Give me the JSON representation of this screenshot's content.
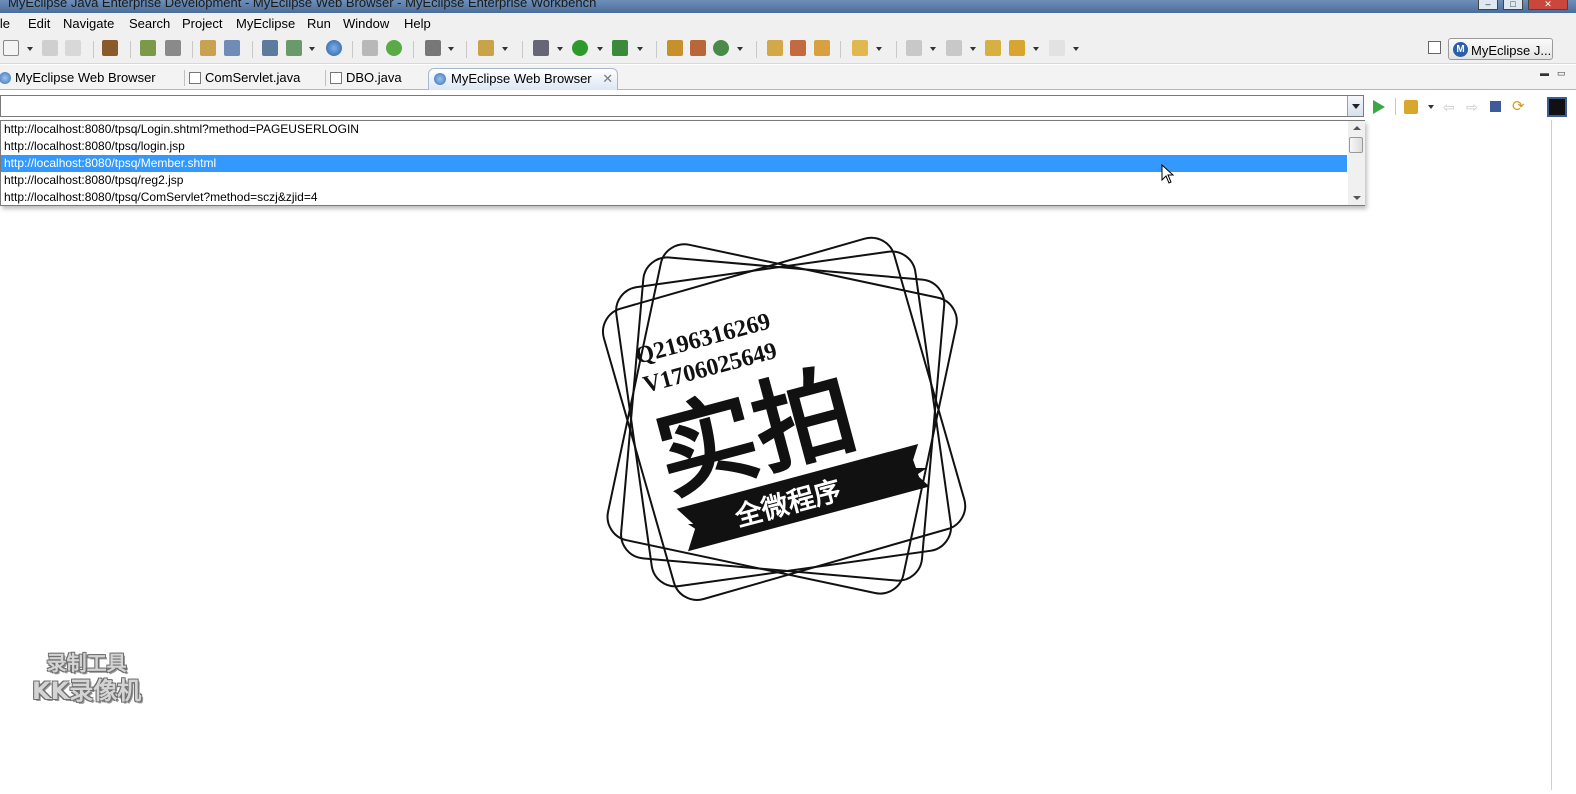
{
  "window": {
    "title": "MyEclipse Java Enterprise Development - MyEclipse Web Browser - MyEclipse Enterprise Workbench"
  },
  "menu": [
    "File",
    "Edit",
    "Navigate",
    "Search",
    "Project",
    "MyEclipse",
    "Run",
    "Window",
    "Help"
  ],
  "perspective": {
    "label": "MyEclipse J..."
  },
  "tabs": [
    {
      "label": "MyEclipse Web Browser",
      "icon": "globe-icon",
      "active": false
    },
    {
      "label": "ComServlet.java",
      "icon": "java-file-icon",
      "active": false
    },
    {
      "label": "DBO.java",
      "icon": "java-file-icon",
      "active": false
    },
    {
      "label": "MyEclipse Web Browser",
      "icon": "globe-icon",
      "active": true
    }
  ],
  "browser": {
    "url_value": "",
    "history": [
      "http://localhost:8080/tpsq/Login.shtml?method=PAGEUSERLOGIN",
      "http://localhost:8080/tpsq/login.jsp",
      "http://localhost:8080/tpsq/Member.shtml",
      "http://localhost:8080/tpsq/reg2.jsp",
      "http://localhost:8080/tpsq/ComServlet?method=sczj&zjid=4"
    ],
    "selected_index": 2
  },
  "watermark": {
    "line1": "Q2196316269",
    "line2": "V1706025649",
    "main": "实拍",
    "banner": "全微程序"
  },
  "recorder": {
    "line1": "录制工具",
    "line2": "KK录像机"
  },
  "colors": {
    "selection": "#3399ff",
    "titlebar": "#4a6c98"
  }
}
